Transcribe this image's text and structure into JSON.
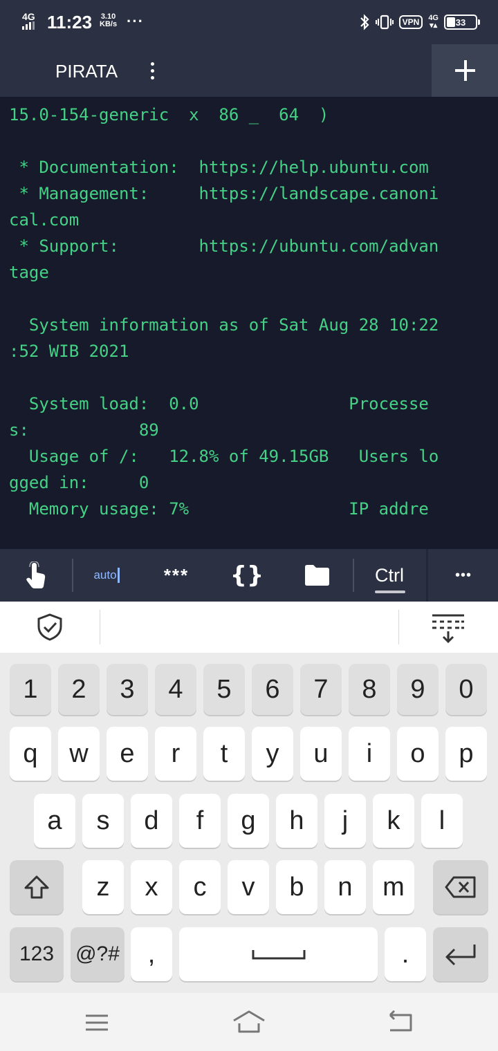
{
  "status_bar": {
    "network": "4G",
    "time": "11:23",
    "speed_value": "3.10",
    "speed_unit": "KB/s",
    "more": "···",
    "vpn": "VPN",
    "signal_label": "4G",
    "battery": "33"
  },
  "app_bar": {
    "title": "PIRATA",
    "add_label": "+"
  },
  "terminal": {
    "lines": [
      "15.0-154-generic  x  86 _  64  )",
      "",
      " * Documentation:  https://help.ubuntu.com",
      " * Management:     https://landscape.canoni",
      "cal.com",
      " * Support:        https://ubuntu.com/advan",
      "tage",
      "",
      "  System information as of Sat Aug 28 10:22",
      ":52 WIB 2021",
      "",
      "  System load:  0.0               Processe",
      "s:           89",
      "  Usage of /:   12.8% of 49.15GB   Users lo",
      "gged in:     0",
      "  Memory usage: 7%                IP addre"
    ],
    "text_color": "#45d186",
    "background": "#161a2a"
  },
  "toolbar": {
    "auto_label": "auto",
    "password_label": "***",
    "braces_label": "{}",
    "ctrl_label": "Ctrl",
    "more_label": "•••"
  },
  "keyboard": {
    "number_row": [
      "1",
      "2",
      "3",
      "4",
      "5",
      "6",
      "7",
      "8",
      "9",
      "0"
    ],
    "row1": [
      "q",
      "w",
      "e",
      "r",
      "t",
      "y",
      "u",
      "i",
      "o",
      "p"
    ],
    "row2": [
      "a",
      "s",
      "d",
      "f",
      "g",
      "h",
      "j",
      "k",
      "l"
    ],
    "row3": [
      "z",
      "x",
      "c",
      "v",
      "b",
      "n",
      "m"
    ],
    "mode_label": "123",
    "symbols_label": "@?#",
    "comma_label": ",",
    "period_label": "."
  }
}
